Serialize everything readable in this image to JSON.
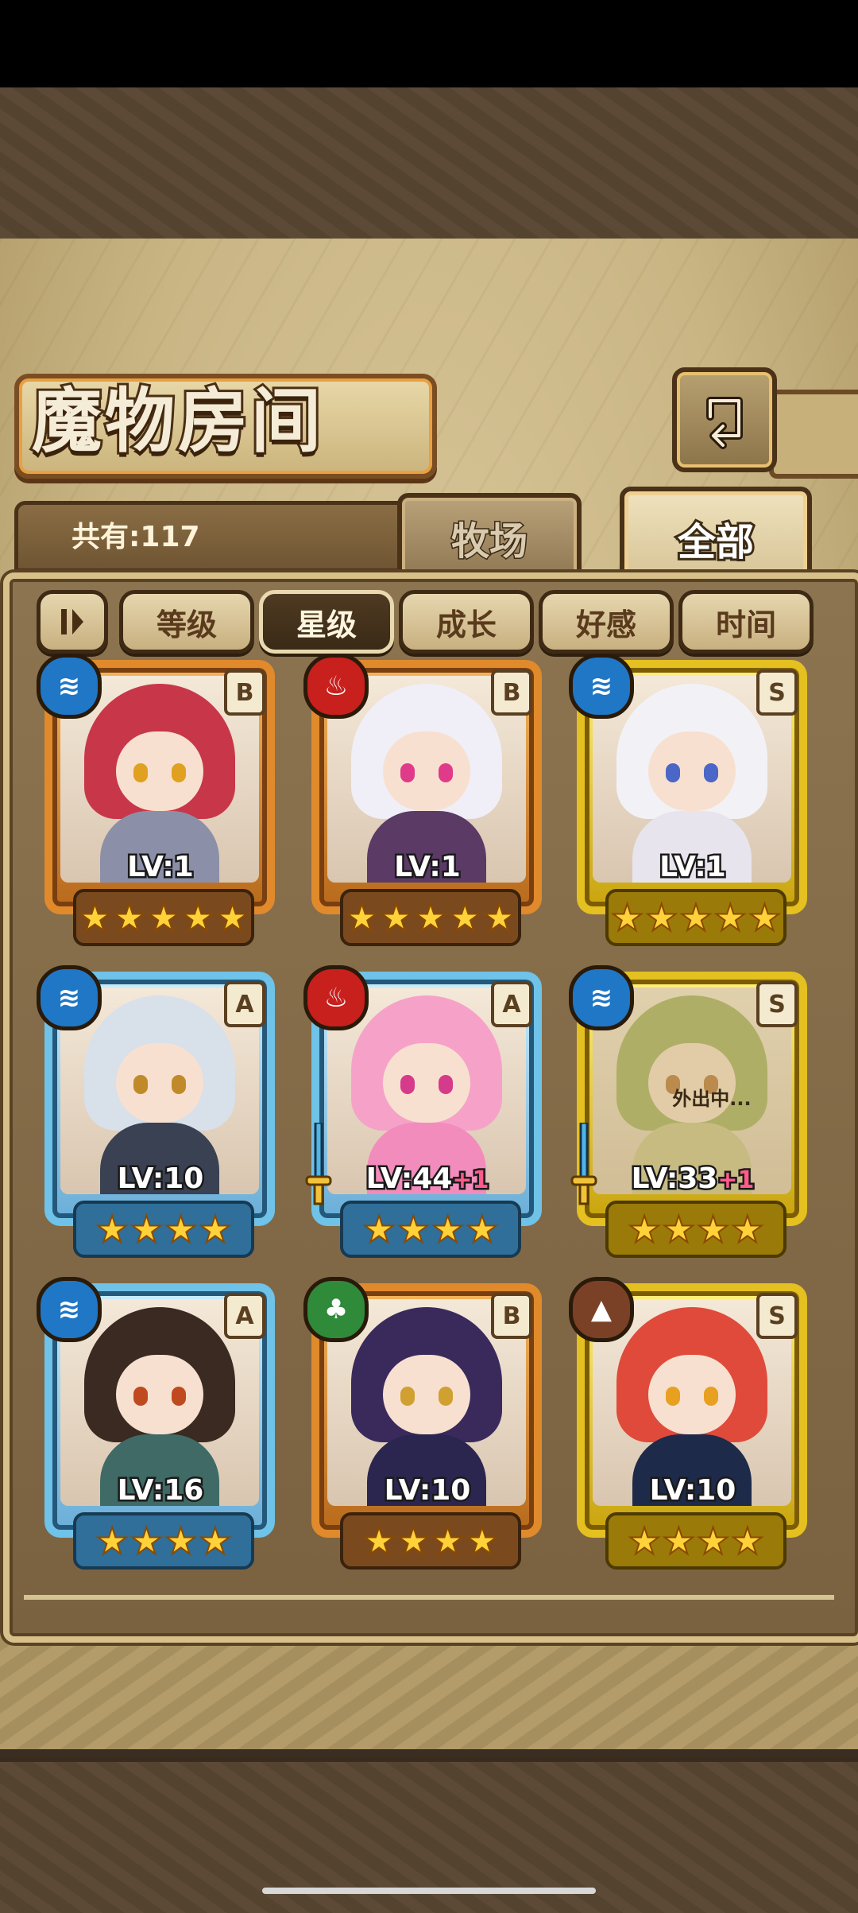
{
  "header": {
    "title": "魔物房间",
    "total_label": "共有:117"
  },
  "tabs": [
    {
      "label": "牧场",
      "active": false
    },
    {
      "label": "全部",
      "active": true
    }
  ],
  "sort": {
    "buttons": [
      {
        "label": "等级",
        "active": false
      },
      {
        "label": "星级",
        "active": true
      },
      {
        "label": "成长",
        "active": false
      },
      {
        "label": "好感",
        "active": false
      },
      {
        "label": "时间",
        "active": false
      }
    ]
  },
  "monsters": [
    {
      "rank": "B",
      "element": "water",
      "element_icon": "≋",
      "frame": "orange",
      "level": "LV:1",
      "plus": "",
      "stars": 5,
      "hair": "#c8364a",
      "outfit": "#8c8fa8",
      "eye": "#e0a020",
      "status": ""
    },
    {
      "rank": "B",
      "element": "fire",
      "element_icon": "♨",
      "frame": "orange",
      "level": "LV:1",
      "plus": "",
      "stars": 5,
      "hair": "#f0eef6",
      "outfit": "#5b3a66",
      "eye": "#e03a8a",
      "status": ""
    },
    {
      "rank": "S",
      "element": "water",
      "element_icon": "≋",
      "frame": "gold",
      "level": "LV:1",
      "plus": "",
      "stars": 5,
      "hair": "#f2f2f6",
      "outfit": "#e8e4ee",
      "eye": "#4a66c6",
      "status": ""
    },
    {
      "rank": "A",
      "element": "water",
      "element_icon": "≋",
      "frame": "blue",
      "level": "LV:10",
      "plus": "",
      "stars": 4,
      "hair": "#d8e0ea",
      "outfit": "#3a4152",
      "eye": "#c08a2a",
      "status": ""
    },
    {
      "rank": "A",
      "element": "fire",
      "element_icon": "♨",
      "frame": "blue",
      "level": "LV:44",
      "plus": "+1",
      "stars": 4,
      "hair": "#f6a2c8",
      "outfit": "#f28cbc",
      "eye": "#d63a8a",
      "status": ""
    },
    {
      "rank": "S",
      "element": "water",
      "element_icon": "≋",
      "frame": "gold",
      "level": "LV:33",
      "plus": "+1",
      "stars": 4,
      "hair": "#9caa5a",
      "outfit": "#c9c28a",
      "eye": "#b06a2a",
      "status": "外出中..."
    },
    {
      "rank": "A",
      "element": "water",
      "element_icon": "≋",
      "frame": "blue",
      "level": "LV:16",
      "plus": "",
      "stars": 4,
      "hair": "#3a2a22",
      "outfit": "#3f6a66",
      "eye": "#c04a20",
      "status": ""
    },
    {
      "rank": "B",
      "element": "nature",
      "element_icon": "♣",
      "frame": "orange",
      "level": "LV:10",
      "plus": "",
      "stars": 4,
      "hair": "#3a2a5c",
      "outfit": "#2b2650",
      "eye": "#d0a030",
      "status": ""
    },
    {
      "rank": "S",
      "element": "earth",
      "element_icon": "▲",
      "frame": "gold",
      "level": "LV:10",
      "plus": "",
      "stars": 4,
      "hair": "#e04a3a",
      "outfit": "#1e2a4a",
      "eye": "#e8a020",
      "status": ""
    }
  ]
}
